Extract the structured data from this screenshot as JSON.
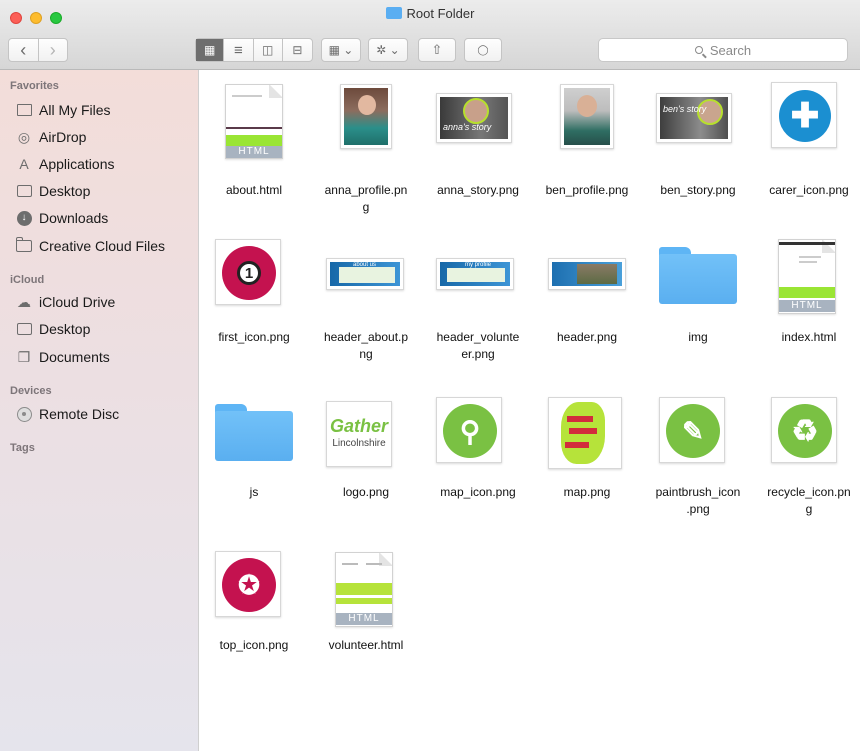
{
  "window": {
    "title": "Root Folder"
  },
  "toolbar": {
    "back": "‹",
    "forward": "›",
    "view_icon": "▦",
    "view_list": "≡",
    "view_columns": "◫",
    "view_cover": "⊟",
    "arrange": "▦ ⌄",
    "action": "✲ ⌄",
    "share": "⇧",
    "tag": "◯",
    "search_placeholder": "Search"
  },
  "sidebar": {
    "favorites_label": "Favorites",
    "favorites": [
      {
        "label": "All My Files",
        "icon": "all-files-icon"
      },
      {
        "label": "AirDrop",
        "icon": "airdrop-icon"
      },
      {
        "label": "Applications",
        "icon": "applications-icon"
      },
      {
        "label": "Desktop",
        "icon": "desktop-icon"
      },
      {
        "label": "Downloads",
        "icon": "downloads-icon"
      },
      {
        "label": "Creative Cloud Files",
        "icon": "folder-icon"
      }
    ],
    "icloud_label": "iCloud",
    "icloud": [
      {
        "label": "iCloud Drive",
        "icon": "cloud-icon"
      },
      {
        "label": "Desktop",
        "icon": "desktop-icon"
      },
      {
        "label": "Documents",
        "icon": "documents-icon"
      }
    ],
    "devices_label": "Devices",
    "devices": [
      {
        "label": "Remote Disc",
        "icon": "disc-icon"
      }
    ],
    "tags_label": "Tags"
  },
  "files": [
    {
      "name": "about.html",
      "kind": "html-doc"
    },
    {
      "name": "anna_profile.pn\ng",
      "kind": "photo"
    },
    {
      "name": "anna_story.png",
      "kind": "photo-story",
      "thumb_text": "anna's story"
    },
    {
      "name": "ben_profile.png",
      "kind": "photo"
    },
    {
      "name": "ben_story.png",
      "kind": "photo-story",
      "thumb_text": "ben's story"
    },
    {
      "name": "carer_icon.png",
      "kind": "badge"
    },
    {
      "name": "first_icon.png",
      "kind": "badge",
      "thumb_text": "1"
    },
    {
      "name": "header_about.p\nng",
      "kind": "banner",
      "thumb_text": "about us"
    },
    {
      "name": "header_volunte\ner.png",
      "kind": "banner",
      "thumb_text": "my profile"
    },
    {
      "name": "header.png",
      "kind": "banner"
    },
    {
      "name": "img",
      "kind": "folder"
    },
    {
      "name": "index.html",
      "kind": "html-doc"
    },
    {
      "name": "js",
      "kind": "folder"
    },
    {
      "name": "logo.png",
      "kind": "logo",
      "thumb_text": "Gather",
      "thumb_subtext": "Lincolnshire"
    },
    {
      "name": "map_icon.png",
      "kind": "badge"
    },
    {
      "name": "map.png",
      "kind": "map"
    },
    {
      "name": "paintbrush_icon\n.png",
      "kind": "badge"
    },
    {
      "name": "recycle_icon.pn\ng",
      "kind": "badge"
    },
    {
      "name": "top_icon.png",
      "kind": "badge"
    },
    {
      "name": "volunteer.html",
      "kind": "html-doc"
    }
  ],
  "thumb_labels": {
    "html": "HTML"
  },
  "colors": {
    "brand_green": "#7ac143",
    "badge_blue": "#1b8fd1",
    "badge_red": "#c4124f",
    "folder_blue": "#5aaff0"
  }
}
